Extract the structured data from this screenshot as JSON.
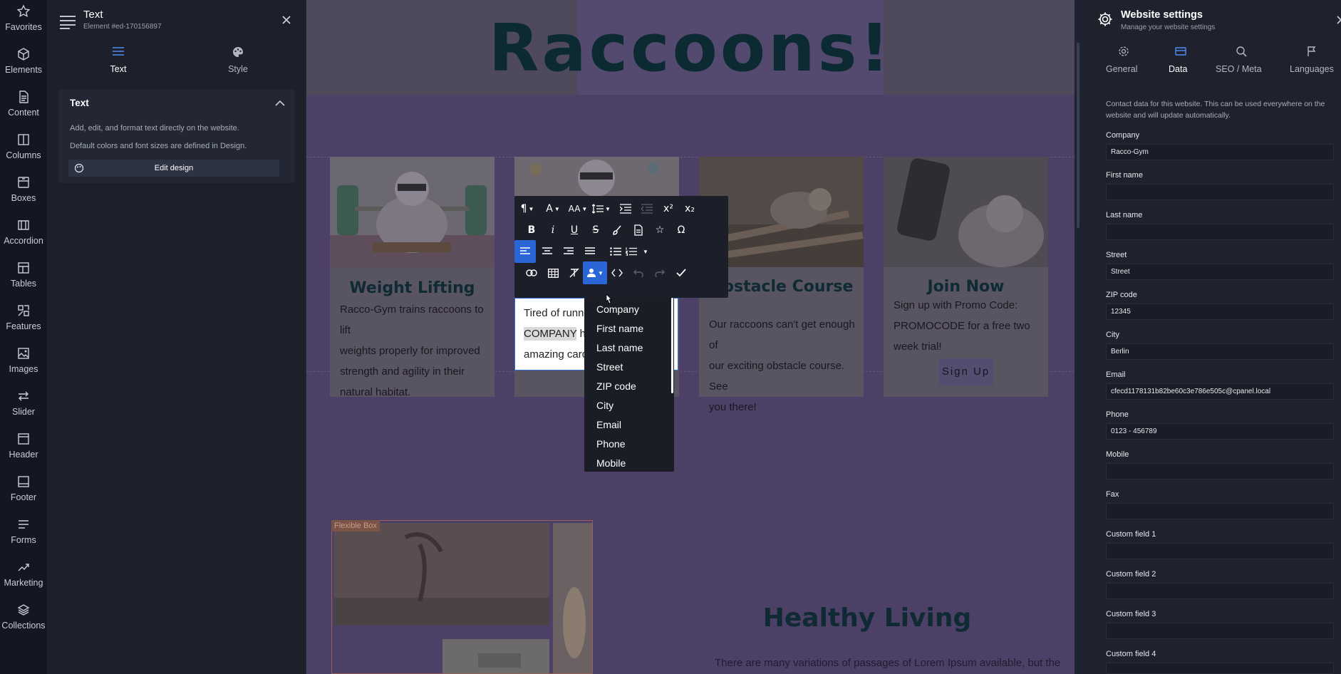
{
  "rail": [
    {
      "label": "Favorites",
      "icon": "star-icon"
    },
    {
      "label": "Elements",
      "icon": "cube-icon"
    },
    {
      "label": "Content",
      "icon": "document-icon"
    },
    {
      "label": "Columns",
      "icon": "columns-icon"
    },
    {
      "label": "Boxes",
      "icon": "box-icon"
    },
    {
      "label": "Accordion",
      "icon": "accordion-icon"
    },
    {
      "label": "Tables",
      "icon": "table-icon"
    },
    {
      "label": "Features",
      "icon": "features-icon"
    },
    {
      "label": "Images",
      "icon": "image-icon"
    },
    {
      "label": "Slider",
      "icon": "slider-icon"
    },
    {
      "label": "Header",
      "icon": "header-icon"
    },
    {
      "label": "Footer",
      "icon": "footer-icon"
    },
    {
      "label": "Forms",
      "icon": "forms-icon"
    },
    {
      "label": "Marketing",
      "icon": "trend-icon"
    },
    {
      "label": "Collections",
      "icon": "layers-icon"
    }
  ],
  "element_panel": {
    "title": "Text",
    "subtitle": "Element #ed-170156897",
    "tabs": [
      {
        "label": "Text"
      },
      {
        "label": "Style"
      }
    ],
    "section": {
      "title": "Text",
      "line1": "Add, edit, and format text directly on the website.",
      "line2": "Default colors and font sizes are defined in Design.",
      "button": "Edit design"
    }
  },
  "canvas": {
    "title": "Raccoons!",
    "cards": [
      {
        "title": "Weight Lifting",
        "text": [
          "Racco-Gym trains raccoons to lift",
          "weights properly for improved",
          "strength and agility in their",
          "natural habitat."
        ]
      },
      {
        "title": "",
        "text": []
      },
      {
        "title": "Obstacle Course",
        "text": [
          "Our raccoons can't get enough of",
          "our exciting obstacle course. See",
          "you there!"
        ]
      },
      {
        "title": "Join Now",
        "text": [
          "Sign up with Promo Code:",
          "PROMOCODE for a free two",
          "week trial!"
        ],
        "button": "Sign Up"
      }
    ],
    "editing_text": {
      "line1": "Tired of runnin",
      "line2_highlight": "COMPANY",
      "line2_rest": " ha",
      "line3": "amazing cardi"
    },
    "flexible_box_label": "Flexible Box",
    "section2_title": "Healthy Living",
    "section2_text": "There are many variations of passages of Lorem Ipsum available, but the"
  },
  "toolbar": {
    "buttons": [
      {
        "name": "paragraph-format-button",
        "glyph": "¶",
        "caret": true
      },
      {
        "name": "text-color-button",
        "glyph": "A",
        "caret": true
      },
      {
        "name": "font-size-button",
        "glyph": "AA",
        "caret": true
      },
      {
        "name": "line-height-button",
        "glyph": "↕≡",
        "caret": true
      },
      {
        "name": "indent-button",
        "glyph": "⇥",
        "caret": false
      },
      {
        "name": "outdent-button",
        "glyph": "⇤",
        "caret": false,
        "disabled": true
      },
      {
        "name": "superscript-button",
        "glyph": "x²",
        "caret": false
      },
      {
        "name": "subscript-button",
        "glyph": "x₂",
        "caret": false
      },
      {
        "name": "bold-button",
        "glyph": "B",
        "caret": false
      },
      {
        "name": "italic-button",
        "glyph": "i",
        "caret": false
      },
      {
        "name": "underline-button",
        "glyph": "U",
        "caret": false
      },
      {
        "name": "strikethrough-button",
        "glyph": "S",
        "caret": false
      },
      {
        "name": "highlight-button",
        "glyph": "✎",
        "caret": false
      },
      {
        "name": "insert-file-button",
        "glyph": "▤",
        "caret": false
      },
      {
        "name": "insert-icon-button",
        "glyph": "☆",
        "caret": false
      },
      {
        "name": "special-characters-button",
        "glyph": "Ω",
        "caret": false
      },
      {
        "name": "align-left-button",
        "glyph": "≡",
        "caret": false,
        "active": true
      },
      {
        "name": "align-center-button",
        "glyph": "≡",
        "caret": false
      },
      {
        "name": "align-right-button",
        "glyph": "≡",
        "caret": false
      },
      {
        "name": "align-justify-button",
        "glyph": "≡",
        "caret": false
      },
      {
        "name": "bulleted-list-button",
        "glyph": "•≡",
        "caret": false
      },
      {
        "name": "numbered-list-button",
        "glyph": "1≡",
        "caret": true
      },
      {
        "name": "insert-link-button",
        "glyph": "⛓",
        "caret": false
      },
      {
        "name": "insert-table-button",
        "glyph": "▦",
        "caret": false
      },
      {
        "name": "clear-format-button",
        "glyph": "T̸",
        "caret": false
      },
      {
        "name": "contact-data-button",
        "glyph": "👤",
        "caret": true,
        "active": true
      },
      {
        "name": "code-view-button",
        "glyph": "<>",
        "caret": false
      },
      {
        "name": "undo-button",
        "glyph": "↶",
        "caret": false,
        "disabled": true
      },
      {
        "name": "redo-button",
        "glyph": "↷",
        "caret": false,
        "disabled": true
      },
      {
        "name": "confirm-button",
        "glyph": "✓",
        "caret": false
      }
    ]
  },
  "dropdown": {
    "items": [
      "Company",
      "First name",
      "Last name",
      "Street",
      "ZIP code",
      "City",
      "Email",
      "Phone",
      "Mobile"
    ]
  },
  "settings": {
    "title": "Website settings",
    "subtitle": "Manage your website settings",
    "tabs": [
      {
        "label": "General"
      },
      {
        "label": "Data"
      },
      {
        "label": "SEO / Meta"
      },
      {
        "label": "Languages"
      }
    ],
    "description": "Contact data for this website. This can be used everywhere on the website and will update automatically.",
    "fields": [
      {
        "label": "Company",
        "value": "Racco-Gym"
      },
      {
        "label": "First name",
        "value": ""
      },
      {
        "label": "Last name",
        "value": ""
      },
      {
        "label": "Street",
        "value": "Street"
      },
      {
        "label": "ZIP code",
        "value": "12345"
      },
      {
        "label": "City",
        "value": "Berlin"
      },
      {
        "label": "Email",
        "value": "cfecd1178131b82be60c3e786e505c@cpanel.local"
      },
      {
        "label": "Phone",
        "value": "0123 - 456789"
      },
      {
        "label": "Mobile",
        "value": ""
      },
      {
        "label": "Fax",
        "value": ""
      },
      {
        "label": "Custom field 1",
        "value": ""
      },
      {
        "label": "Custom field 2",
        "value": ""
      },
      {
        "label": "Custom field 3",
        "value": ""
      },
      {
        "label": "Custom field 4",
        "value": ""
      }
    ]
  }
}
